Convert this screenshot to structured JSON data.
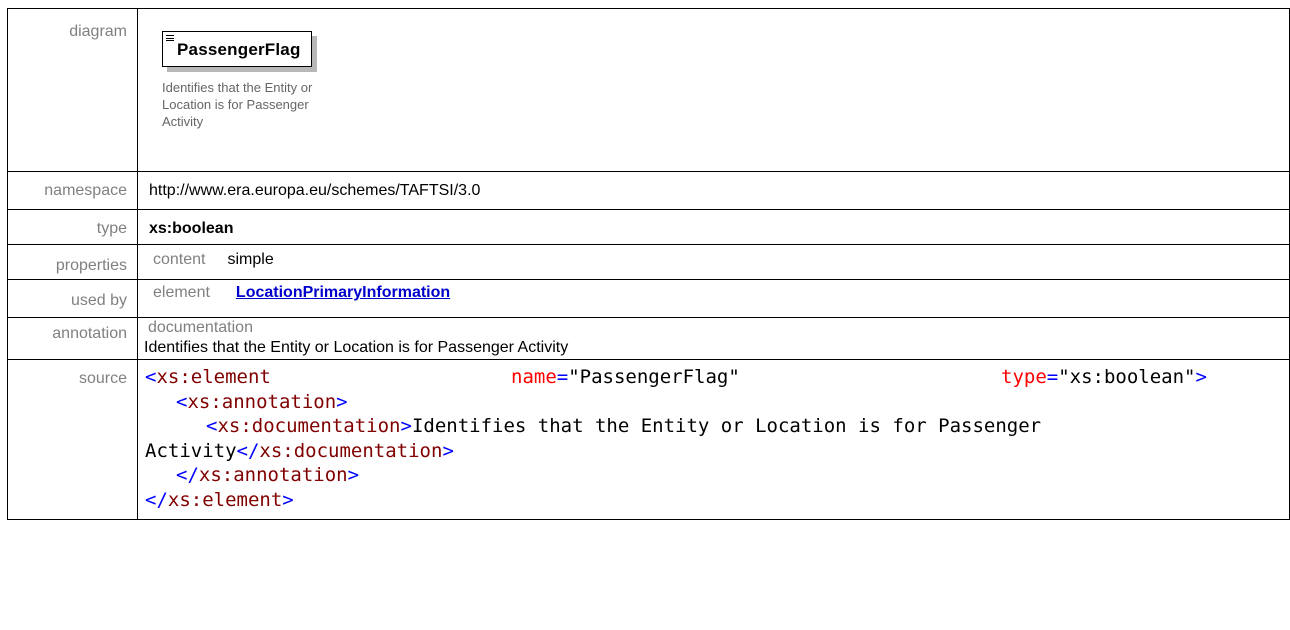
{
  "rows": {
    "diagram": {
      "label": "diagram",
      "element_name": "PassengerFlag",
      "element_doc": "Identifies that the Entity or Location is for Passenger Activity"
    },
    "namespace": {
      "label": "namespace",
      "value": "http://www.era.europa.eu/schemes/TAFTSI/3.0"
    },
    "type": {
      "label": "type",
      "value": "xs:boolean"
    },
    "properties": {
      "label": "properties",
      "key": "content",
      "value": "simple"
    },
    "used_by": {
      "label": "used by",
      "key": "element",
      "value": "LocationPrimaryInformation"
    },
    "annotation": {
      "label": "annotation",
      "key": "documentation",
      "value": "Identifies that the Entity or Location is for Passenger Activity"
    },
    "source": {
      "label": "source",
      "line1": {
        "open": "<",
        "tag": "xs:element",
        "attr1_name": "name",
        "eq": "=",
        "attr1_value": "\"PassengerFlag\"",
        "attr2_name": "type",
        "attr2_value": "\"xs:boolean\"",
        "close": ">"
      },
      "line2": {
        "open": "<",
        "tag": "xs:annotation",
        "close": ">"
      },
      "line3": {
        "open": "<",
        "tag": "xs:documentation",
        "close": ">",
        "text": "Identifies that the Entity or Location is for Passenger"
      },
      "line4": {
        "text": "Activity",
        "open": "</",
        "tag": "xs:documentation",
        "close": ">"
      },
      "line5": {
        "open": "</",
        "tag": "xs:annotation",
        "close": ">"
      },
      "line6": {
        "open": "</",
        "tag": "xs:element",
        "close": ">"
      }
    }
  }
}
